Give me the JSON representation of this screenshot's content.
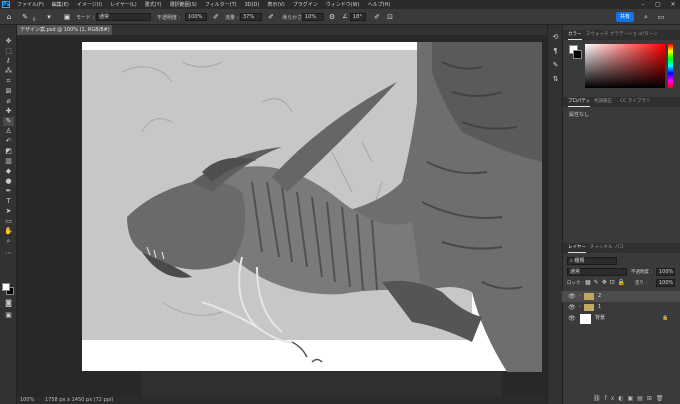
{
  "app": {
    "logo": "Ps"
  },
  "menu": [
    "ファイル(F)",
    "編集(E)",
    "イメージ(I)",
    "レイヤー(L)",
    "書式(Y)",
    "選択範囲(S)",
    "フィルター(T)",
    "3D(D)",
    "表示(V)",
    "プラグイン",
    "ウィンドウ(W)",
    "ヘルプ(H)"
  ],
  "options": {
    "brush_size": "6",
    "mode_label": "モード :",
    "mode_value": "通常",
    "opacity_label": "不透明度 :",
    "opacity_value": "100%",
    "flow_label": "流量 :",
    "flow_value": "37%",
    "smoothing_label": "滑らかさ :",
    "smoothing_value": "10%",
    "angle_value": "18°",
    "share_label": "共有"
  },
  "document": {
    "tab_title": "デザイン案.psd @ 100% (1, RGB/8#) *",
    "zoom": "100%",
    "doc_info": "1758 px x 1450 px (72 ppi)"
  },
  "color_panel": {
    "tabs": [
      "カラー",
      "スウォッチ",
      "グラデーション",
      "パターン"
    ],
    "active": 0
  },
  "properties_panel": {
    "tabs": [
      "プロパティ",
      "色調補正",
      "CC ライブラリ"
    ],
    "active": 0,
    "content": "属性なし"
  },
  "layers_panel": {
    "tabs": [
      "レイヤー",
      "チャンネル",
      "パス"
    ],
    "active": 0,
    "filter_label": "種類",
    "blend_mode": "通常",
    "opacity_label": "不透明度 :",
    "opacity_value": "100%",
    "lock_label": "ロック :",
    "fill_label": "塗り :",
    "fill_value": "100%",
    "layers": [
      {
        "name": "2",
        "selected": true
      },
      {
        "name": "1",
        "selected": false
      },
      {
        "name": "背景",
        "selected": false
      }
    ]
  },
  "colors": {
    "accent": "#1473e6",
    "foreground": "#ffffff",
    "background": "#000000"
  }
}
